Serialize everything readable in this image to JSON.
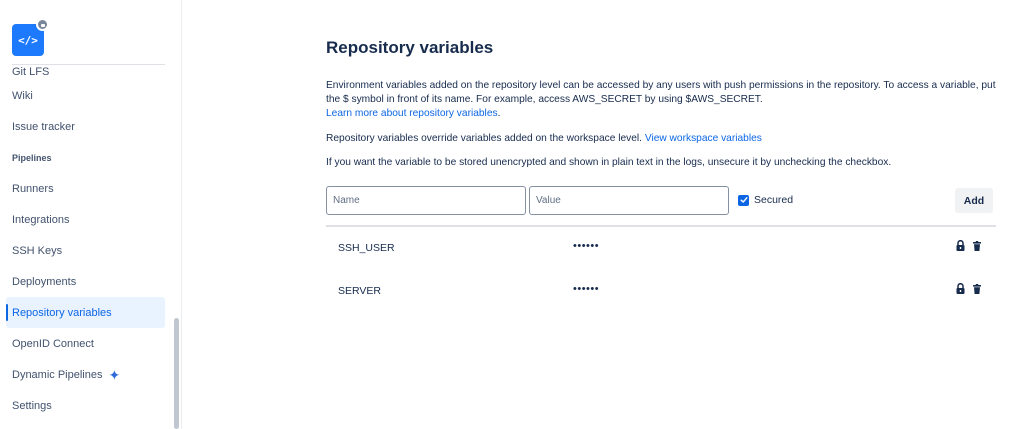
{
  "sidebar": {
    "logo_glyph": "</>",
    "items": [
      {
        "label": "Git LFS"
      },
      {
        "label": "Wiki"
      },
      {
        "label": "Issue tracker"
      }
    ],
    "section_pipelines": "Pipelines",
    "pipeline_items": [
      {
        "label": "Runners"
      },
      {
        "label": "Integrations"
      },
      {
        "label": "SSH Keys"
      },
      {
        "label": "Deployments"
      },
      {
        "label": "Repository variables",
        "active": true
      },
      {
        "label": "OpenID Connect"
      },
      {
        "label": "Dynamic Pipelines"
      },
      {
        "label": "Settings"
      }
    ]
  },
  "main": {
    "title": "Repository variables",
    "description_1": "Environment variables added on the repository level can be accessed by any users with push permissions in the repository. To access a variable, put the $ symbol in front of its name. For example, access AWS_SECRET by using $AWS_SECRET.",
    "learn_more_link": "Learn more about repository variables",
    "description_2": "Repository variables override variables added on the workspace level.",
    "workspace_link": "View workspace variables",
    "description_3": "If you want the variable to be stored unencrypted and shown in plain text in the logs, unsecure it by unchecking the checkbox.",
    "form": {
      "name_placeholder": "Name",
      "value_placeholder": "Value",
      "secured_label": "Secured",
      "secured_checked": true,
      "add_label": "Add"
    },
    "variables": [
      {
        "name": "SSH_USER",
        "value": "••••••",
        "secured": true
      },
      {
        "name": "SERVER",
        "value": "••••••",
        "secured": true
      }
    ]
  },
  "colors": {
    "accent": "#0c66e4",
    "logo_bg": "#1d7afc",
    "active_bg": "#e9f2ff",
    "text": "#172b4d"
  },
  "icons": {
    "logo": "code-icon",
    "sparkle": "sparkle-icon",
    "lock": "lock-icon",
    "delete": "trash-icon",
    "check": "check-icon"
  }
}
